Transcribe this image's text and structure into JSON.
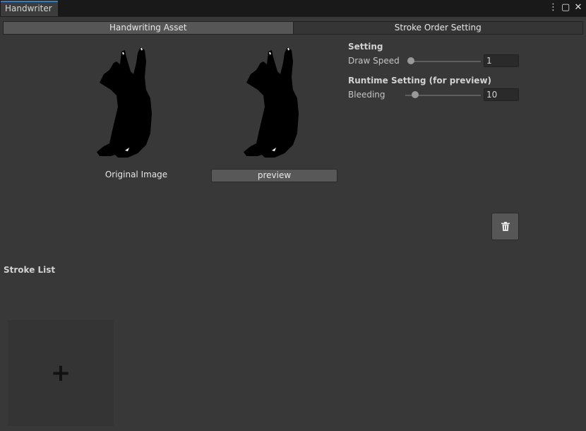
{
  "window": {
    "tab_title": "Handwriter",
    "controls": {
      "menu": "⋮",
      "maximize": "▢",
      "close": "✕"
    }
  },
  "tabs": [
    {
      "label": "Handwriting Asset",
      "active": true
    },
    {
      "label": "Stroke Order Setting",
      "active": false
    }
  ],
  "images": {
    "original_label": "Original Image",
    "preview_button": "preview"
  },
  "setting": {
    "header": "Setting",
    "draw_speed": {
      "label": "Draw Speed",
      "value": "1"
    }
  },
  "runtime_setting": {
    "header": "Runtime Setting (for preview)",
    "bleeding": {
      "label": "Bleeding",
      "value": "10"
    }
  },
  "stroke_list": {
    "title": "Stroke List",
    "add_symbol": "+"
  },
  "colors": {
    "background": "#383838",
    "title_accent": "#3a79bb",
    "silhouette": "#000000"
  }
}
